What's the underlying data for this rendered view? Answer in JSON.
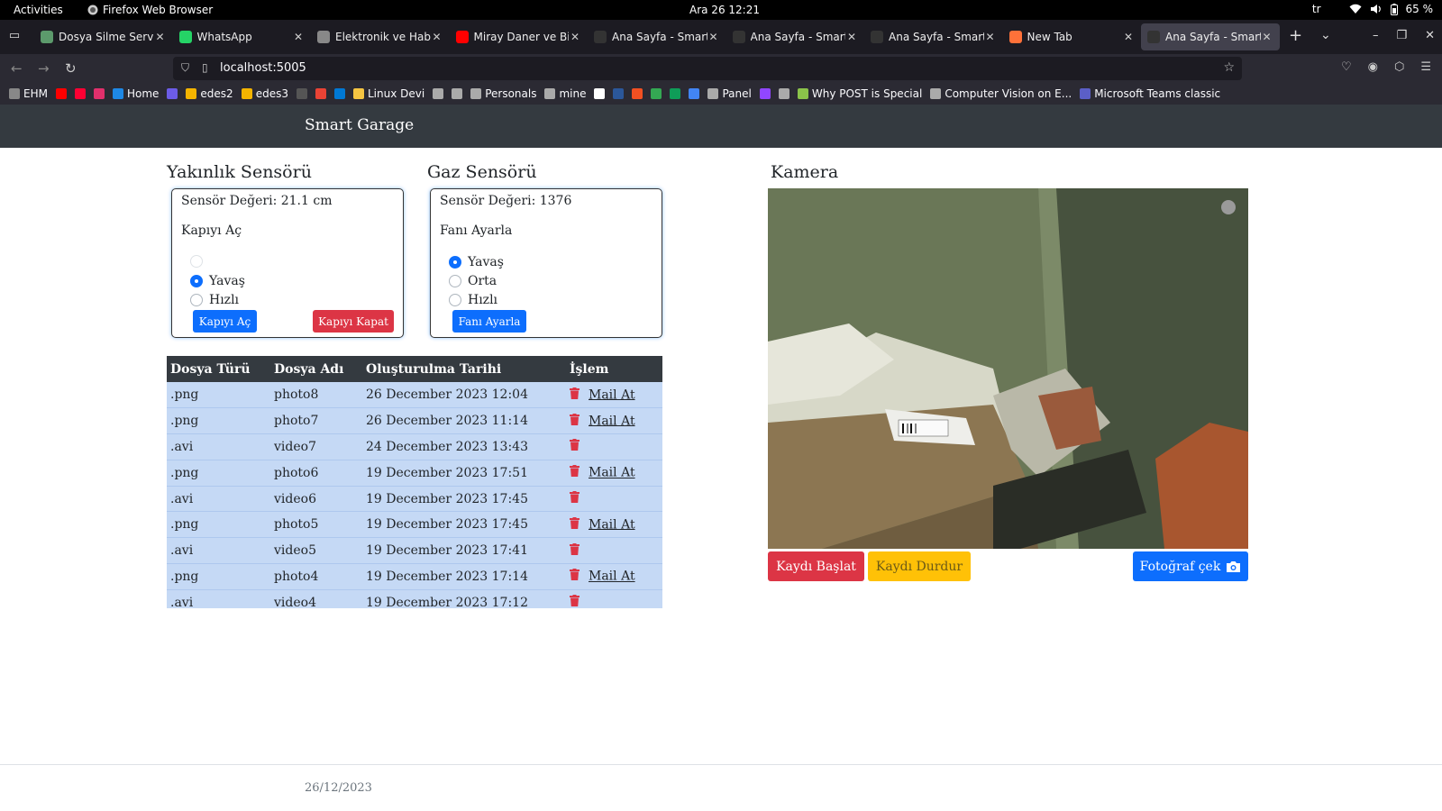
{
  "system": {
    "activities": "Activities",
    "app_name": "Firefox Web Browser",
    "clock": "Ara 26  12:21",
    "language": "tr",
    "battery": "65 %"
  },
  "browser": {
    "tabs": [
      {
        "title": "Dosya Silme Servisi",
        "favicon_color": "#5c9a6c",
        "active": false
      },
      {
        "title": "WhatsApp",
        "favicon_color": "#25d366",
        "active": false
      },
      {
        "title": "Elektronik ve Habe",
        "favicon_color": "#888888",
        "active": false
      },
      {
        "title": "Miray Daner ve Bir",
        "favicon_color": "#ff0000",
        "active": false
      },
      {
        "title": "Ana Sayfa - Smart G",
        "favicon_color": "#333333",
        "active": false
      },
      {
        "title": "Ana Sayfa - Smart G",
        "favicon_color": "#333333",
        "active": false
      },
      {
        "title": "Ana Sayfa - Smart G",
        "favicon_color": "#333333",
        "active": false
      },
      {
        "title": "New Tab",
        "favicon_color": "#ff7139",
        "active": false
      },
      {
        "title": "Ana Sayfa - Smart G",
        "favicon_color": "#333333",
        "active": true
      }
    ],
    "url": "localhost:5005",
    "bookmarks": [
      {
        "label": "EHM",
        "color": "#888888"
      },
      {
        "label": "",
        "color": "#ff0000"
      },
      {
        "label": "",
        "color": "#ff0033"
      },
      {
        "label": "",
        "color": "#e1306c"
      },
      {
        "label": "Home",
        "color": "#1e88e5"
      },
      {
        "label": "",
        "color": "#6c5ce7"
      },
      {
        "label": "edes2",
        "color": "#f4b400"
      },
      {
        "label": "edes3",
        "color": "#f4b400"
      },
      {
        "label": "",
        "color": "#555555"
      },
      {
        "label": "",
        "color": "#ea4335"
      },
      {
        "label": "",
        "color": "#0078d4"
      },
      {
        "label": "Linux Devi",
        "color": "#f5c542"
      },
      {
        "label": "",
        "color": "#aaaaaa"
      },
      {
        "label": "",
        "color": "#aaaaaa"
      },
      {
        "label": "Personals",
        "color": "#aaaaaa"
      },
      {
        "label": "mine",
        "color": "#aaaaaa"
      },
      {
        "label": "",
        "color": "#ffffff"
      },
      {
        "label": "",
        "color": "#2b579a"
      },
      {
        "label": "",
        "color": "#f25022"
      },
      {
        "label": "",
        "color": "#34a853"
      },
      {
        "label": "",
        "color": "#0f9d58"
      },
      {
        "label": "",
        "color": "#4285f4"
      },
      {
        "label": "Panel",
        "color": "#aaaaaa"
      },
      {
        "label": "",
        "color": "#9146ff"
      },
      {
        "label": "",
        "color": "#aaaaaa"
      },
      {
        "label": "Why POST is Special",
        "color": "#8bc34a"
      },
      {
        "label": "Computer Vision on E...",
        "color": "#aaaaaa"
      },
      {
        "label": "Microsoft Teams classic",
        "color": "#5b5fc7"
      }
    ]
  },
  "app": {
    "brand": "Smart Garage",
    "proximity": {
      "title": "Yakınlık Sensörü",
      "value": "Sensör Değeri: 21.1 cm",
      "label": "Kapıyı Aç",
      "options": [
        "",
        "Yavaş",
        "Hızlı"
      ],
      "selected": 1,
      "open_button": "Kapıyı Aç",
      "close_button": "Kapıyı Kapat"
    },
    "gas": {
      "title": "Gaz Sensörü",
      "value": "Sensör Değeri: 1376",
      "label": "Fanı Ayarla",
      "options": [
        "Yavaş",
        "Orta",
        "Hızlı"
      ],
      "selected": 0,
      "button": "Fanı Ayarla"
    },
    "files": {
      "headers": [
        "Dosya Türü",
        "Dosya Adı",
        "Oluşturulma Tarihi",
        "İşlem"
      ],
      "rows": [
        {
          "type": ".png",
          "name": "photo8",
          "date": "26 December 2023 12:04",
          "mail": "Mail At"
        },
        {
          "type": ".png",
          "name": "photo7",
          "date": "26 December 2023 11:14",
          "mail": "Mail At"
        },
        {
          "type": ".avi",
          "name": "video7",
          "date": "24 December 2023 13:43",
          "mail": ""
        },
        {
          "type": ".png",
          "name": "photo6",
          "date": "19 December 2023 17:51",
          "mail": "Mail At"
        },
        {
          "type": ".avi",
          "name": "video6",
          "date": "19 December 2023 17:45",
          "mail": ""
        },
        {
          "type": ".png",
          "name": "photo5",
          "date": "19 December 2023 17:45",
          "mail": "Mail At"
        },
        {
          "type": ".avi",
          "name": "video5",
          "date": "19 December 2023 17:41",
          "mail": ""
        },
        {
          "type": ".png",
          "name": "photo4",
          "date": "19 December 2023 17:14",
          "mail": "Mail At"
        },
        {
          "type": ".avi",
          "name": "video4",
          "date": "19 December 2023 17:12",
          "mail": ""
        }
      ]
    },
    "camera": {
      "title": "Kamera",
      "start_button": "Kaydı Başlat",
      "stop_button": "Kaydı Durdur",
      "photo_button": "Fotoğraf çek"
    },
    "footer_date": "26/12/2023"
  },
  "colors": {
    "primary": "#0d6efd",
    "danger": "#dc3545",
    "warning": "#ffc107",
    "dark": "#343a40",
    "row_bg": "#c5d9f5"
  }
}
